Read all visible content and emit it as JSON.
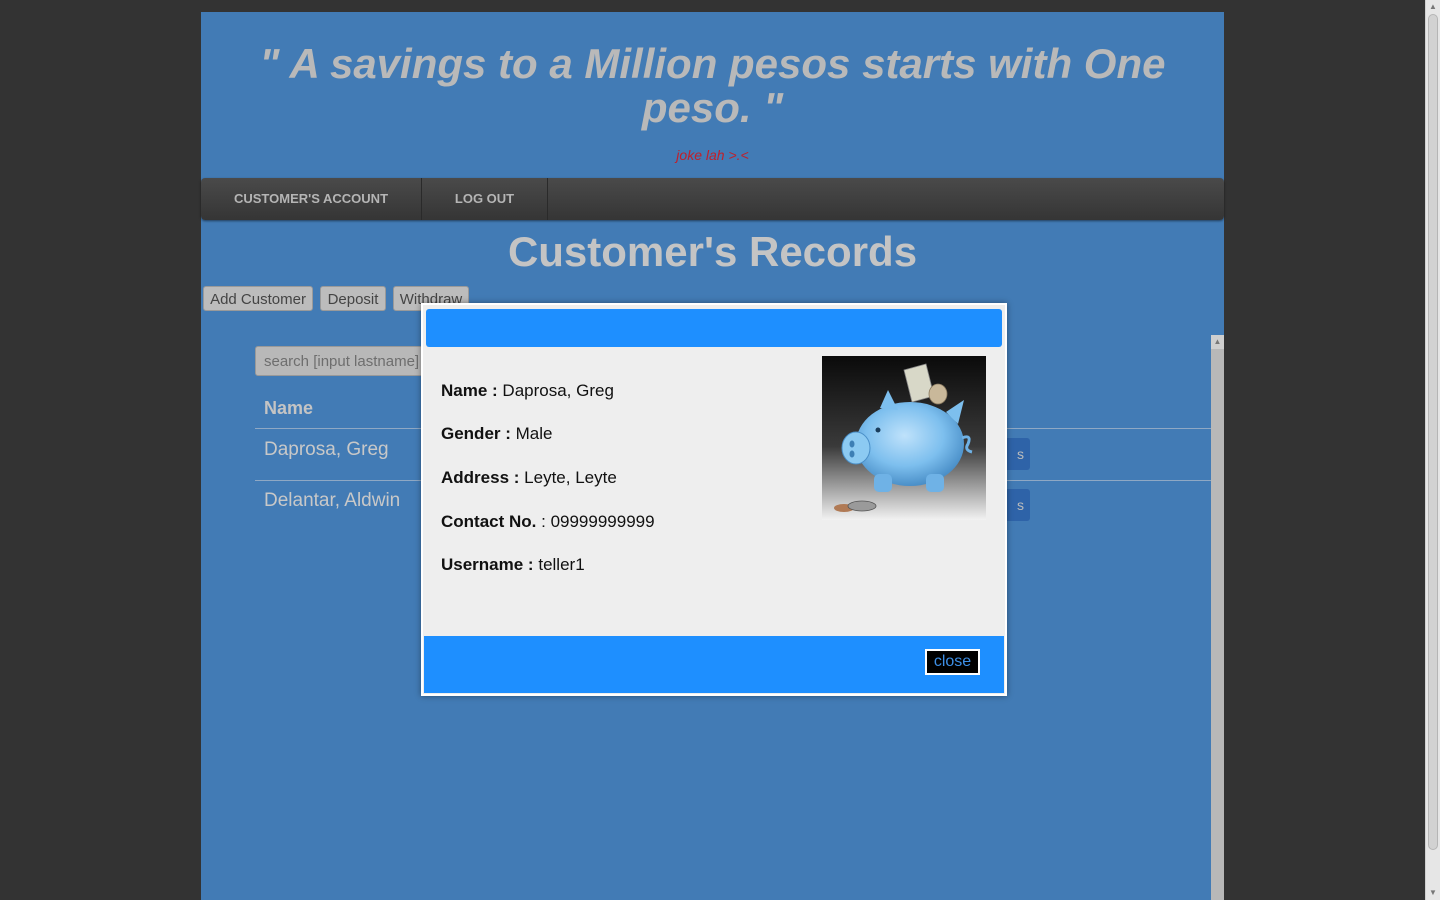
{
  "header": {
    "quote": "\" A savings to a Million pesos starts with One peso. \"",
    "subtitle": "joke lah >.<"
  },
  "nav": {
    "items": [
      {
        "label": "CUSTOMER'S ACCOUNT"
      },
      {
        "label": "LOG OUT"
      }
    ]
  },
  "main": {
    "title": "Customer's Records",
    "buttons": {
      "add": "Add Customer",
      "deposit": "Deposit",
      "withdraw": "Withdraw"
    },
    "search": {
      "placeholder": "search [input lastname]",
      "value": ""
    },
    "table": {
      "columns": [
        "Name"
      ],
      "rows": [
        {
          "name": "Daprosa, Greg",
          "action": "s"
        },
        {
          "name": "Delantar, Aldwin",
          "action": "s"
        }
      ]
    }
  },
  "modal": {
    "fields": [
      {
        "label": "Name :",
        "value": "Daprosa, Greg"
      },
      {
        "label": "Gender :",
        "value": "Male"
      },
      {
        "label": "Address :",
        "value": "Leyte, Leyte"
      },
      {
        "label": "Contact No.",
        "value": ": 09999999999"
      },
      {
        "label": "Username :",
        "value": "teller1"
      }
    ],
    "close_label": "close",
    "image_icon": "piggy-bank-image"
  },
  "colors": {
    "page_bg": "#427bb5",
    "modal_accent": "#1e8fff",
    "subtitle": "#c0202a"
  }
}
